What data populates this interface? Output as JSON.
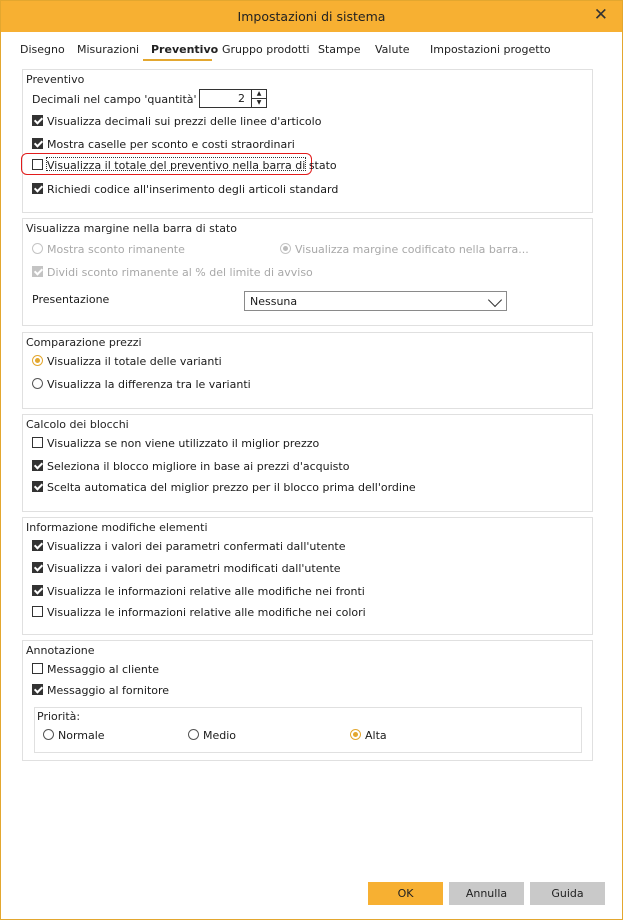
{
  "window": {
    "title": "Impostazioni di sistema"
  },
  "tabs": [
    "Disegno",
    "Misurazioni",
    "Preventivo",
    "Gruppo prodotti",
    "Stampe",
    "Valute",
    "Impostazioni progetto"
  ],
  "active_tab": "Preventivo",
  "preventivo": {
    "title": "Preventivo",
    "decimals_label": "Decimali nel campo 'quantità'",
    "decimals_value": "2",
    "options": [
      {
        "label": "Visualizza decimali sui prezzi delle linee d'articolo",
        "checked": true
      },
      {
        "label": "Mostra caselle per sconto e costi straordinari",
        "checked": true
      },
      {
        "label": "Visualizza il totale del preventivo nella barra di stato",
        "checked": false
      },
      {
        "label": "Richiedi codice all'inserimento degli articoli standard",
        "checked": true
      }
    ]
  },
  "margin": {
    "title": "Visualizza margine nella barra di stato",
    "radio_left": "Mostra sconto rimanente",
    "radio_right": "Visualizza margine codificato nella barra...",
    "divide_label": "Dividi sconto rimanente al % del limite di avviso",
    "presentation_label": "Presentazione",
    "presentation_value": "Nessuna"
  },
  "price_compare": {
    "title": "Comparazione prezzi",
    "options": [
      "Visualizza il totale delle varianti",
      "Visualizza la differenza tra le varianti"
    ],
    "selected": 0
  },
  "blocks": {
    "title": "Calcolo dei blocchi",
    "options": [
      {
        "label": "Visualizza se non viene utilizzato il miglior prezzo",
        "checked": false
      },
      {
        "label": "Seleziona il blocco migliore in base ai prezzi d'acquisto",
        "checked": true
      },
      {
        "label": "Scelta automatica del miglior prezzo per il blocco prima dell'ordine",
        "checked": true
      }
    ]
  },
  "changes": {
    "title": "Informazione modifiche elementi",
    "options": [
      {
        "label": "Visualizza i valori dei parametri confermati dall'utente",
        "checked": true
      },
      {
        "label": "Visualizza i valori dei parametri modificati dall'utente",
        "checked": true
      },
      {
        "label": "Visualizza le informazioni relative alle modifiche nei fronti",
        "checked": true
      },
      {
        "label": "Visualizza le informazioni relative alle modifiche nei colori",
        "checked": false
      }
    ]
  },
  "annotation": {
    "title": "Annotazione",
    "options": [
      {
        "label": "Messaggio al cliente",
        "checked": false
      },
      {
        "label": "Messaggio al fornitore",
        "checked": true
      }
    ],
    "priority_title": "Priorità:",
    "priorities": [
      "Normale",
      "Medio",
      "Alta"
    ],
    "selected_priority": 2
  },
  "buttons": {
    "ok": "OK",
    "cancel": "Annulla",
    "help": "Guida"
  },
  "colors": {
    "accent": "#f7b032",
    "highlight": "#e21c1c"
  }
}
